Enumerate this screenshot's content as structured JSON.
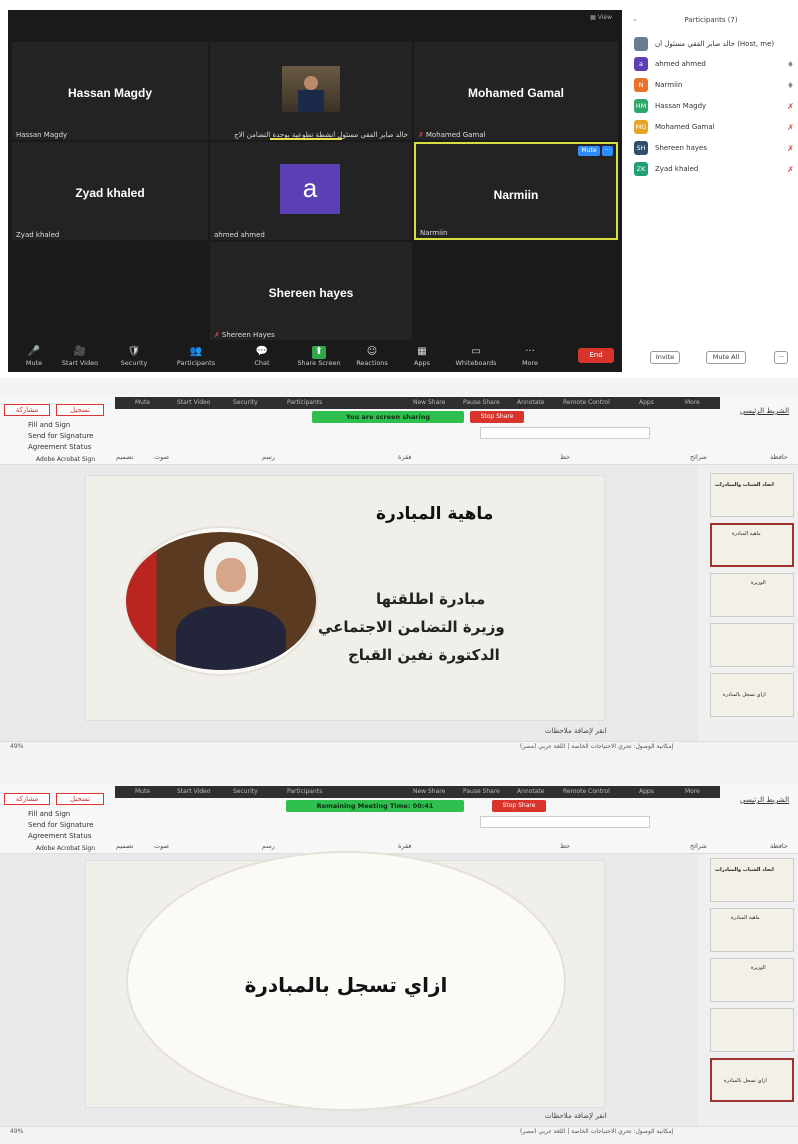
{
  "zoom": {
    "view_label": "View",
    "tiles": [
      {
        "name": "Hassan Magdy",
        "label": "Hassan Magdy",
        "muted": false
      },
      {
        "name": "",
        "label": "خالد صابر الفقي مسئول أنشطة تطوعية بوحدة التضامن الاج",
        "muted": false
      },
      {
        "name": "Mohamed Gamal",
        "label": "Mohamed Gamal",
        "muted": true
      },
      {
        "name": "Zyad khaled",
        "label": "Zyad khaled",
        "muted": false
      },
      {
        "name": "",
        "label": "ahmed ahmed",
        "avatar_letter": "a",
        "muted": false
      },
      {
        "name": "Narmiin",
        "label": "Narmiin",
        "muted": false
      },
      {
        "name": "Shereen hayes",
        "label": "Shereen Hayes",
        "muted": true
      }
    ],
    "tile_menu_label": "Mute",
    "tile_more": "···",
    "toolbar": [
      {
        "icon": "mic-icon",
        "glyph": "🎤",
        "label": "Mute"
      },
      {
        "icon": "video-icon",
        "glyph": "🎥",
        "label": "Start Video"
      },
      {
        "icon": "security-icon",
        "glyph": "🛡",
        "label": "Security"
      },
      {
        "icon": "participants-icon",
        "glyph": "👥",
        "label": "Participants"
      },
      {
        "icon": "chat-icon",
        "glyph": "💬",
        "label": "Chat"
      },
      {
        "icon": "share-screen-icon",
        "glyph": "⬆",
        "label": "Share Screen"
      },
      {
        "icon": "reactions-icon",
        "glyph": "☺",
        "label": "Reactions"
      },
      {
        "icon": "apps-icon",
        "glyph": "▦",
        "label": "Apps"
      },
      {
        "icon": "whiteboard-icon",
        "glyph": "▭",
        "label": "Whiteboards"
      },
      {
        "icon": "more-icon",
        "glyph": "···",
        "label": "More"
      }
    ],
    "end_label": "End",
    "participants_panel": {
      "title": "Participants (7)",
      "people": [
        {
          "name": "خالد صابر الفقي مسئول أن",
          "suffix": "(Host, me)",
          "initials": "",
          "color": "#6b7c8f",
          "mic": "🎤"
        },
        {
          "name": "ahmed ahmed",
          "initials": "a",
          "color": "#5b3fb5",
          "mic": "🎤"
        },
        {
          "name": "Narmiin",
          "initials": "N",
          "color": "#e8732b",
          "mic": "🎤"
        },
        {
          "name": "Hassan Magdy",
          "initials": "HM",
          "color": "#2ea86a",
          "mic": "🎤"
        },
        {
          "name": "Mohamed Gamal",
          "initials": "MG",
          "color": "#e5a426",
          "mic": "🎤"
        },
        {
          "name": "Shereen hayes",
          "initials": "SH",
          "color": "#2f4f6f",
          "mic": "🎤"
        },
        {
          "name": "Zyad khaled",
          "initials": "ZK",
          "color": "#1f9e77",
          "mic": "🎤"
        }
      ],
      "invite_label": "Invite",
      "mute_all_label": "Mute All",
      "more_label": "···"
    }
  },
  "ppt1": {
    "share_bar_items": [
      "Mute",
      "Start Video",
      "Security",
      "Participants",
      "New Share",
      "Pause Share",
      "Annotate",
      "Remote Control",
      "Apps",
      "More"
    ],
    "green_label": "You are screen sharing",
    "stop_share": "Stop Share",
    "record_label": "تسجيل",
    "share_label": "مشاركة",
    "home_tab": "الشريط الرئيسي",
    "acrobat": [
      "Fill and Sign",
      "Send for Signature",
      "Agreement Status",
      "Adobe Acrobat Sign"
    ],
    "groups": [
      "تصميم",
      "صوت",
      "رسم",
      "فقرة",
      "خط",
      "شرائح",
      "حافظة"
    ],
    "slide_title": "ماهية المبادرة",
    "slide_lines": [
      "مبادرة اطلقتها",
      "وزيرة التضامن الاجتماعي",
      "الدكتورة نفين القباج"
    ],
    "notes": "انقر لإضافة ملاحظات",
    "zoom_level": "49%",
    "status_text": "إمكانية الوصول: تحري الاحتياجات الخاصة | اللغة عربي (مصر)"
  },
  "ppt2": {
    "green_label": "Remaining Meeting Time: 00:41",
    "stop_share": "Stop Share",
    "slide_title": "ازاي تسجل بالمبادرة",
    "notes": "انقر لإضافة ملاحظات",
    "zoom_level": "49%"
  },
  "thumbs": [
    "اتحاد الشباب والمبادرات",
    "ماهية المبادرة",
    "الوزيرة",
    "",
    "ازاي تسجل بالمبادرة"
  ]
}
